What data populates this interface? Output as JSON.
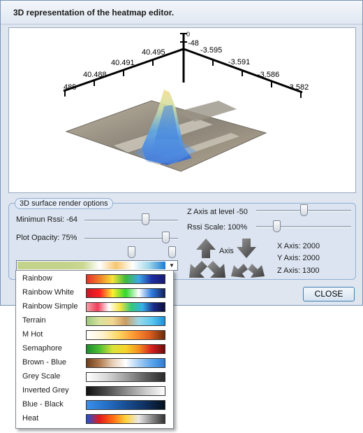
{
  "window": {
    "title": "3D representation of the heatmap editor."
  },
  "axes": {
    "vertical_top": "0",
    "vertical_second": "-48",
    "left_ticks": [
      "40.495",
      "40.491",
      "40.488",
      "485"
    ],
    "right_ticks": [
      "-3.595",
      "-3.591",
      "-3.586",
      "-3.582"
    ]
  },
  "options": {
    "legend": "3D surface render options",
    "min_rssi": "Minimun Rssi: -64",
    "plot_opacity": "Plot Opacity: 75%",
    "z_axis_level": "Z Axis at level -50",
    "rssi_scale": "Rssi Scale: 100%",
    "axis_label": "Axis",
    "x_axis": "X Axis: 2000",
    "y_axis": "Y Axis: 2000",
    "z_axis": "Z Axis: 1300",
    "min_rssi_pos": 0.65,
    "opacity_pos": 0.87,
    "z_level_pos": 0.5,
    "rssi_scale_pos": 0.22,
    "range_low": 0.5,
    "range_high": 0.94
  },
  "close_button": "CLOSE",
  "palettes": [
    {
      "name": "Rainbow",
      "colors": [
        "#e8302c",
        "#f07f2a",
        "#f6e33a",
        "#3dba3a",
        "#3fa8e8",
        "#1d2fa2",
        "#1a1a70"
      ]
    },
    {
      "name": "Rainbow White",
      "colors": [
        "#c8182a",
        "#ff2020",
        "#ffef30",
        "#2ed82e",
        "#ffffff",
        "#2c7be0",
        "#14205a"
      ]
    },
    {
      "name": "Rainbow Simple",
      "colors": [
        "#f4a0a8",
        "#ef3d5a",
        "#ffffff",
        "#f5e444",
        "#33c97a",
        "#35b0e8",
        "#1b2d8a",
        "#0c0c3a"
      ]
    },
    {
      "name": "Terrain",
      "colors": [
        "#9cc67d",
        "#d8e39d",
        "#f2d690",
        "#c99c60",
        "#9cd7e8",
        "#5cc8f0",
        "#1e8fd9"
      ]
    },
    {
      "name": "M Hot",
      "colors": [
        "#ffffff",
        "#fff2d0",
        "#ffd966",
        "#ff9933",
        "#e0601f",
        "#6a2c0c"
      ]
    },
    {
      "name": "Semaphore",
      "colors": [
        "#1b8c2d",
        "#4fbf34",
        "#d9e23a",
        "#f7d42c",
        "#f49020",
        "#d51f1f",
        "#6e0a0a"
      ]
    },
    {
      "name": "Brown - Blue",
      "colors": [
        "#6e3e1c",
        "#b07a4f",
        "#e7cfb5",
        "#ffffff",
        "#a9cef3",
        "#5aa4ea",
        "#2b7ed8"
      ]
    },
    {
      "name": "Grey Scale",
      "colors": [
        "#ffffff",
        "#d9d9d9",
        "#a0a0a0",
        "#606060",
        "#2a2a2a"
      ]
    },
    {
      "name": "Inverted Grey",
      "colors": [
        "#111111",
        "#4a4a4a",
        "#8a8a8a",
        "#c8c8c8",
        "#ffffff"
      ]
    },
    {
      "name": "Blue - Black",
      "colors": [
        "#3a8fe8",
        "#2570c8",
        "#184e94",
        "#0f3060",
        "#05101c"
      ]
    },
    {
      "name": "Heat",
      "colors": [
        "#1c52d8",
        "#e21a1a",
        "#ff6a12",
        "#ffd13a",
        "#e8e8e8",
        "#8a8a8a",
        "#333333"
      ]
    }
  ],
  "combo_colors": [
    "#c3d38c",
    "#c3d38c",
    "#c3d38c",
    "#c3d38c",
    "#cad891",
    "#ffffff",
    "#f6c66e",
    "#ffffff",
    "#9fd7ea",
    "#1d7bd6"
  ],
  "colors": {
    "accent": "#3c7fb1",
    "window_bg": "#dfe6f0"
  }
}
